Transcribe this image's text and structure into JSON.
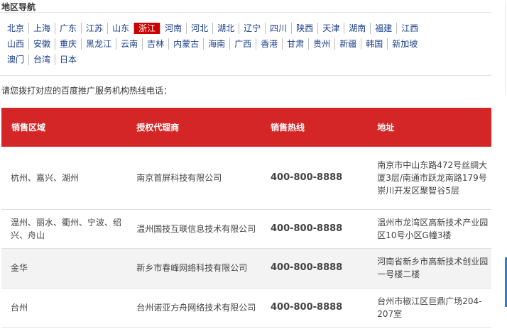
{
  "nav_title": "地区导航",
  "regions_row1": [
    "北京",
    "上海",
    "广东",
    "江苏",
    "山东",
    "浙江",
    "河南",
    "河北",
    "湖北",
    "辽宁",
    "四川",
    "陕西",
    "天津",
    "湖南",
    "福建",
    "江西"
  ],
  "regions_row2": [
    "山西",
    "安徽",
    "重庆",
    "黑龙江",
    "云南",
    "吉林",
    "内蒙古",
    "海南",
    "广西",
    "香港",
    "甘肃",
    "贵州",
    "新疆",
    "韩国",
    "新加坡"
  ],
  "regions_row3": [
    "澳门",
    "台湾",
    "日本"
  ],
  "active_region": "浙江",
  "prompt": "请您拨打对应的百度推广服务机构热线电话：",
  "table": {
    "headers": [
      "销售区域",
      "授权代理商",
      "销售热线",
      "地址"
    ],
    "rows": [
      {
        "area": "杭州、嘉兴、湖州",
        "agent": "南京首屏科技有限公司",
        "phone": "400-800-8888",
        "address": "南京市中山东路472号丝绸大厦3层/南通市跃龙南路179号崇川开发区聚智谷5层"
      },
      {
        "area": "温州、丽水、衢州、宁波、绍兴、舟山",
        "agent": "温州国技互联信息技术有限公司",
        "phone": "400-800-8888",
        "address": "温州市龙湾区高新技术产业园区10号小区G幢3楼"
      },
      {
        "area": "金华",
        "agent": "新乡市春峰网络科技有限公司",
        "phone": "400-800-8888",
        "address": "河南省新乡市高新技术创业园一号楼二楼"
      },
      {
        "area": "台州",
        "agent": "台州诺亚方舟网络技术有限公司",
        "phone": "400-800-8888",
        "address": "台州市椒江区巨鼎广场204-207室"
      }
    ]
  },
  "colors": {
    "header_bg": "#d42626",
    "active_bg": "#cc0000",
    "link": "#1a3f8a"
  }
}
